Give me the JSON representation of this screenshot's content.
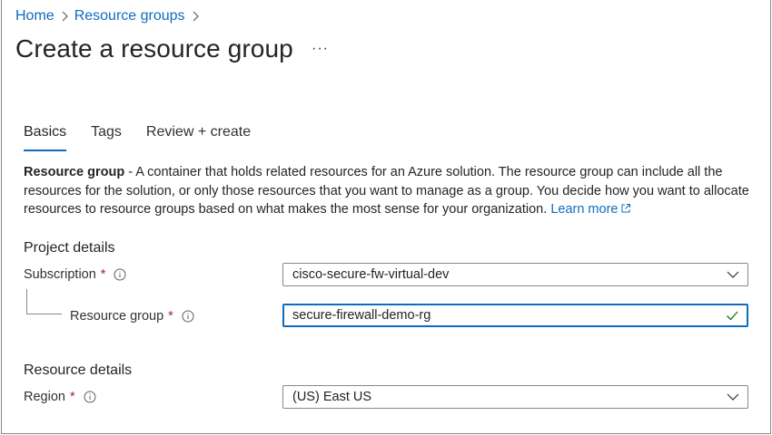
{
  "breadcrumb": {
    "home": "Home",
    "resource_groups": "Resource groups"
  },
  "page": {
    "title": "Create a resource group",
    "more_label": "···"
  },
  "tabs": [
    {
      "label": "Basics",
      "active": true
    },
    {
      "label": "Tags",
      "active": false
    },
    {
      "label": "Review + create",
      "active": false
    }
  ],
  "description": {
    "term": "Resource group",
    "text": " - A container that holds related resources for an Azure solution. The resource group can include all the resources for the solution, or only those resources that you want to manage as a group. You decide how you want to allocate resources to resource groups based on what makes the most sense for your organization. ",
    "learn_more": "Learn more"
  },
  "project_details": {
    "heading": "Project details",
    "subscription": {
      "label": "Subscription",
      "required": "*",
      "value": "cisco-secure-fw-virtual-dev"
    },
    "resource_group": {
      "label": "Resource group",
      "required": "*",
      "value": "secure-firewall-demo-rg"
    }
  },
  "resource_details": {
    "heading": "Resource details",
    "region": {
      "label": "Region",
      "required": "*",
      "value": "(US) East US"
    }
  },
  "colors": {
    "accent": "#0f6cbd",
    "required": "#a4262c",
    "valid": "#107c10",
    "border": "#8a8886"
  },
  "icons": {
    "separator": "chevron-right-icon",
    "info": "info-icon",
    "dropdown": "chevron-down-icon",
    "valid": "checkmark-icon",
    "external": "external-link-icon"
  }
}
